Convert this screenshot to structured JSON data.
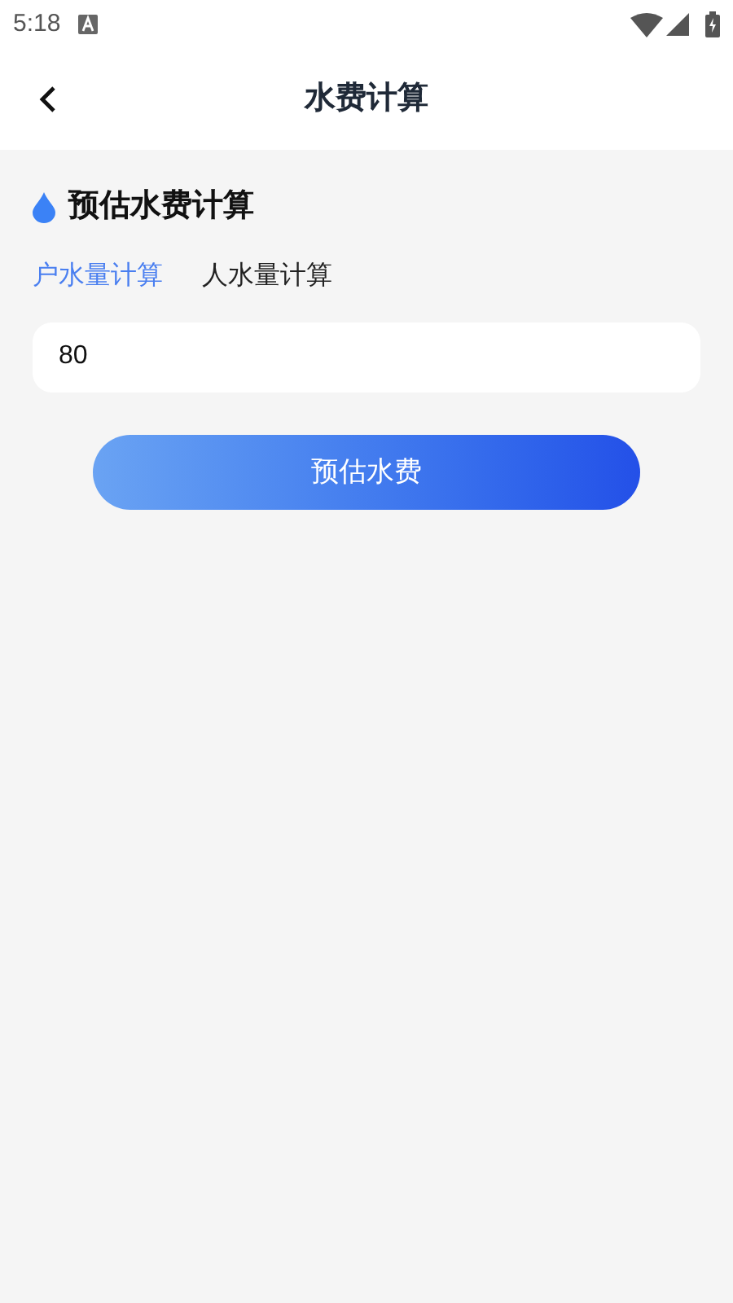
{
  "status_bar": {
    "time": "5:18"
  },
  "header": {
    "title": "水费计算"
  },
  "section": {
    "title": "预估水费计算"
  },
  "tabs": [
    {
      "label": "户水量计算",
      "selected": true
    },
    {
      "label": "人水量计算",
      "selected": false
    }
  ],
  "input": {
    "value": "80"
  },
  "button": {
    "label": "预估水费"
  }
}
